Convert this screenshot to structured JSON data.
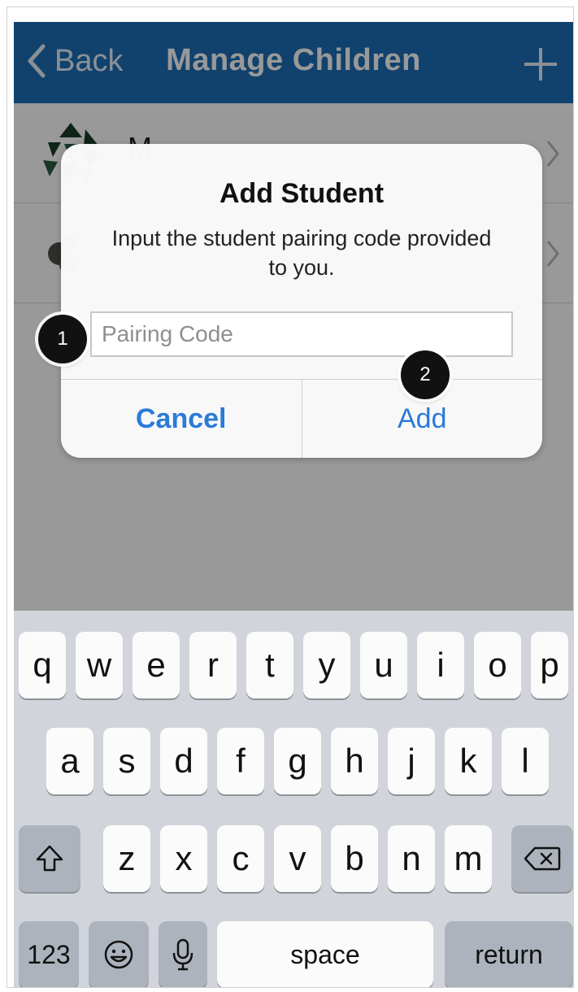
{
  "navbar": {
    "back_label": "Back",
    "title": "Manage Children",
    "add_icon": "plus-icon"
  },
  "children_list": {
    "items": [
      {
        "name": "M"
      },
      {
        "name": ""
      }
    ]
  },
  "dialog": {
    "title": "Add Student",
    "message": "Input the student pairing code provided to you.",
    "input_placeholder": "Pairing Code",
    "input_value": "",
    "cancel_label": "Cancel",
    "add_label": "Add"
  },
  "callouts": {
    "one": "1",
    "two": "2"
  },
  "keyboard": {
    "row1": [
      "q",
      "w",
      "e",
      "r",
      "t",
      "y",
      "u",
      "i",
      "o",
      "p"
    ],
    "row2": [
      "a",
      "s",
      "d",
      "f",
      "g",
      "h",
      "j",
      "k",
      "l"
    ],
    "row3": [
      "z",
      "x",
      "c",
      "v",
      "b",
      "n",
      "m"
    ],
    "numbers_label": "123",
    "space_label": "space",
    "return_label": "return",
    "shift_icon": "shift-icon",
    "backspace_icon": "backspace-icon",
    "emoji_icon": "emoji-icon",
    "mic_icon": "microphone-icon"
  },
  "colors": {
    "navbar_bg": "#1d6fb8",
    "accent": "#2a7ad9",
    "keyboard_bg": "#d1d4da"
  }
}
